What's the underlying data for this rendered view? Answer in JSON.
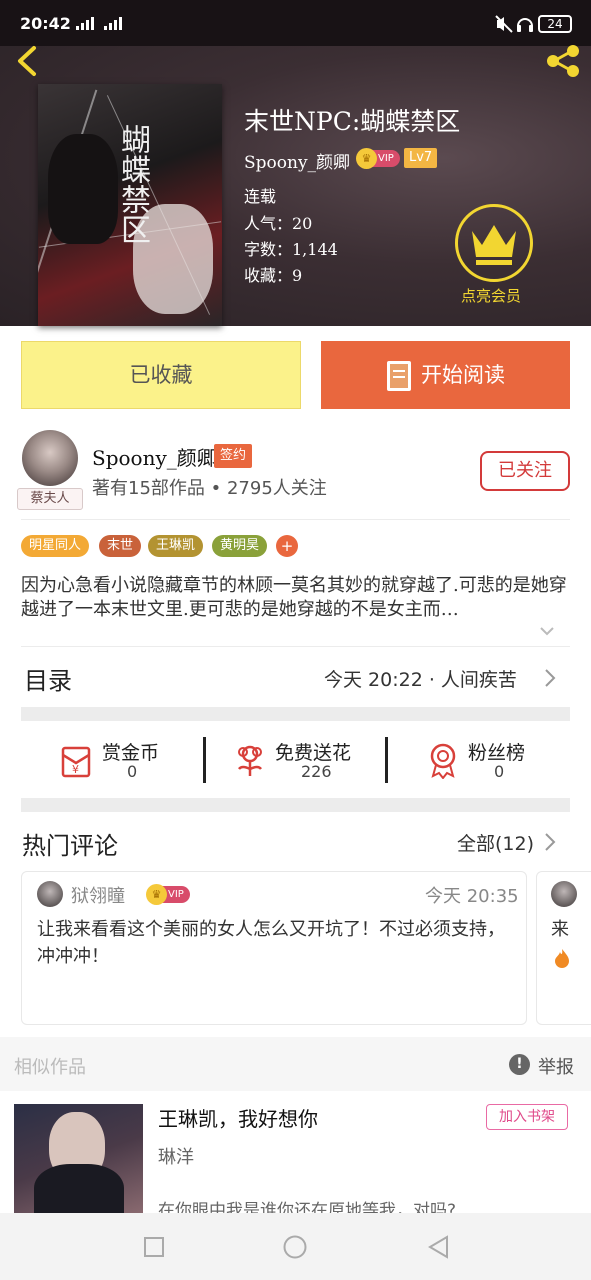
{
  "status_bar": {
    "time": "20:42",
    "net1": "4G",
    "net2": "2G",
    "battery": "24"
  },
  "book": {
    "title": "末世NPC:蝴蝶禁区",
    "cover_title": "蝴蝶禁区",
    "author": "Spoony_颜卿",
    "vip_label": "VIP",
    "level": "Lv7",
    "status": "连载",
    "popularity": "人气：20",
    "word_count": "字数：1,144",
    "favorites": "收藏：9"
  },
  "vip_promo": {
    "label": "点亮会员"
  },
  "actions": {
    "favorited_label": "已收藏",
    "read_label": "开始阅读"
  },
  "author_info": {
    "name": "Spoony_颜卿",
    "avatar_tag": "蔡夫人",
    "sign_badge": "签约",
    "summary": "著有15部作品 • 2795人关注",
    "follow_label": "已关注"
  },
  "tags": [
    {
      "label": "明星同人",
      "color": "#f3a935"
    },
    {
      "label": "末世",
      "color": "#c9623a"
    },
    {
      "label": "王琳凯",
      "color": "#b39331"
    },
    {
      "label": "黄明昊",
      "color": "#8aa13a"
    }
  ],
  "tag_more": "+",
  "synopsis": "因为心急看小说隐藏章节的林顾一莫名其妙的就穿越了.可悲的是她穿越进了一本末世文里.更可悲的是她穿越的不是女主而…",
  "catalog": {
    "title": "目录",
    "latest": "今天 20:22 · 人间疾苦"
  },
  "stats": [
    {
      "label": "赏金币",
      "value": "0",
      "icon": "red-envelope-icon"
    },
    {
      "label": "免费送花",
      "value": "226",
      "icon": "flower-icon"
    },
    {
      "label": "粉丝榜",
      "value": "0",
      "icon": "medal-icon"
    }
  ],
  "comments": {
    "title": "热门评论",
    "all_label": "全部(12)",
    "items": [
      {
        "user": "狱翎瞳",
        "vip": "VIP",
        "time": "今天 20:35",
        "text": "让我来看看这个美丽的女人怎么又开坑了！不过必须支持，冲冲冲！"
      },
      {
        "user": "",
        "text": "来"
      }
    ]
  },
  "similar": {
    "label": "相似作品",
    "report_label": "举报",
    "items": [
      {
        "title": "王琳凯，我好想你",
        "author": "琳洋",
        "desc": "在你眼中我是谁你还在原地等我，对吗?",
        "shelf_label": "加入书架"
      }
    ]
  },
  "colors": {
    "accent": "#e9673e",
    "gold": "#f2d631",
    "follow_red": "#d33a3a"
  }
}
